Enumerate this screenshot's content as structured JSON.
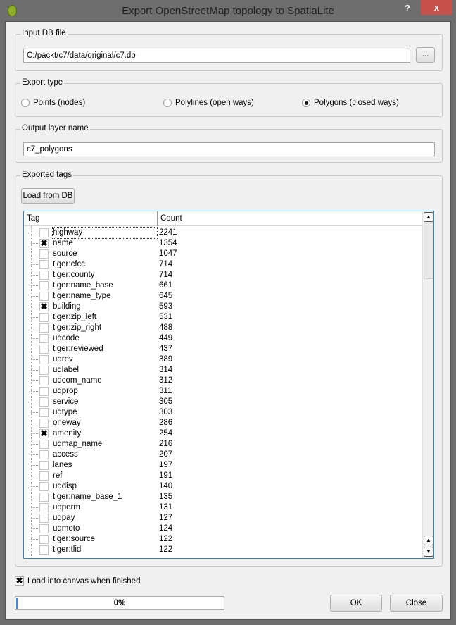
{
  "window": {
    "title": "Export OpenStreetMap topology to SpatiaLite",
    "help": "?",
    "close": "x"
  },
  "input_db": {
    "label": "Input DB file",
    "value": "C:/packt/c7/data/original/c7.db",
    "browse": "..."
  },
  "export_type": {
    "label": "Export type",
    "options": [
      {
        "label": "Points (nodes)",
        "selected": false
      },
      {
        "label": "Polylines (open ways)",
        "selected": false
      },
      {
        "label": "Polygons (closed ways)",
        "selected": true
      }
    ]
  },
  "output_layer": {
    "label": "Output layer name",
    "value": "c7_polygons"
  },
  "tags": {
    "label": "Exported tags",
    "load_button": "Load from DB",
    "headers": [
      "Tag",
      "Count"
    ],
    "rows": [
      {
        "tag": "highway",
        "count": "2241",
        "checked": false
      },
      {
        "tag": "name",
        "count": "1354",
        "checked": true
      },
      {
        "tag": "source",
        "count": "1047",
        "checked": false
      },
      {
        "tag": "tiger:cfcc",
        "count": "714",
        "checked": false
      },
      {
        "tag": "tiger:county",
        "count": "714",
        "checked": false
      },
      {
        "tag": "tiger:name_base",
        "count": "661",
        "checked": false
      },
      {
        "tag": "tiger:name_type",
        "count": "645",
        "checked": false
      },
      {
        "tag": "building",
        "count": "593",
        "checked": true
      },
      {
        "tag": "tiger:zip_left",
        "count": "531",
        "checked": false
      },
      {
        "tag": "tiger:zip_right",
        "count": "488",
        "checked": false
      },
      {
        "tag": "udcode",
        "count": "449",
        "checked": false
      },
      {
        "tag": "tiger:reviewed",
        "count": "437",
        "checked": false
      },
      {
        "tag": "udrev",
        "count": "389",
        "checked": false
      },
      {
        "tag": "udlabel",
        "count": "314",
        "checked": false
      },
      {
        "tag": "udcom_name",
        "count": "312",
        "checked": false
      },
      {
        "tag": "udprop",
        "count": "311",
        "checked": false
      },
      {
        "tag": "service",
        "count": "305",
        "checked": false
      },
      {
        "tag": "udtype",
        "count": "303",
        "checked": false
      },
      {
        "tag": "oneway",
        "count": "286",
        "checked": false
      },
      {
        "tag": "amenity",
        "count": "254",
        "checked": true
      },
      {
        "tag": "udmap_name",
        "count": "216",
        "checked": false
      },
      {
        "tag": "access",
        "count": "207",
        "checked": false
      },
      {
        "tag": "lanes",
        "count": "197",
        "checked": false
      },
      {
        "tag": "ref",
        "count": "191",
        "checked": false
      },
      {
        "tag": "uddisp",
        "count": "140",
        "checked": false
      },
      {
        "tag": "tiger:name_base_1",
        "count": "135",
        "checked": false
      },
      {
        "tag": "udperm",
        "count": "131",
        "checked": false
      },
      {
        "tag": "udpay",
        "count": "127",
        "checked": false
      },
      {
        "tag": "udmoto",
        "count": "124",
        "checked": false
      },
      {
        "tag": "tiger:source",
        "count": "122",
        "checked": false
      },
      {
        "tag": "tiger:tlid",
        "count": "122",
        "checked": false
      }
    ]
  },
  "load_canvas": {
    "label": "Load into canvas when finished",
    "checked": true
  },
  "progress": {
    "text": "0%",
    "value": 0
  },
  "buttons": {
    "ok": "OK",
    "close": "Close"
  }
}
